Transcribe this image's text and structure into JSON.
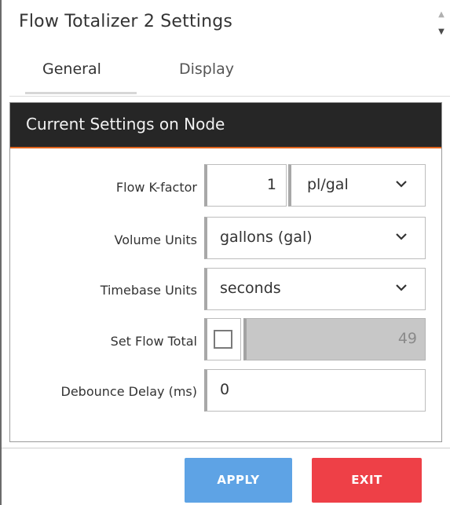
{
  "window": {
    "title": "Flow Totalizer 2 Settings"
  },
  "tabs": [
    {
      "label": "General",
      "active": true
    },
    {
      "label": "Display",
      "active": false
    }
  ],
  "section": {
    "header": "Current Settings on Node"
  },
  "form": {
    "flow_k_factor": {
      "label": "Flow K-factor",
      "value": "1",
      "unit": "pl/gal"
    },
    "volume_units": {
      "label": "Volume Units",
      "value": "gallons (gal)"
    },
    "timebase_units": {
      "label": "Timebase Units",
      "value": "seconds"
    },
    "set_flow_total": {
      "label": "Set Flow Total",
      "checked": false,
      "value": "49"
    },
    "debounce_delay": {
      "label": "Debounce Delay (ms)",
      "value": "0"
    }
  },
  "buttons": {
    "apply": "APPLY",
    "exit": "EXIT"
  },
  "colors": {
    "header_bg": "#262626",
    "header_accent": "#e1641c",
    "apply": "#5ea3e5",
    "exit": "#ee4047"
  },
  "icons": {
    "dropdown": "chevron-down-icon",
    "scroll_up": "scroll-up-arrow-icon",
    "scroll_down": "scroll-down-arrow-icon"
  }
}
